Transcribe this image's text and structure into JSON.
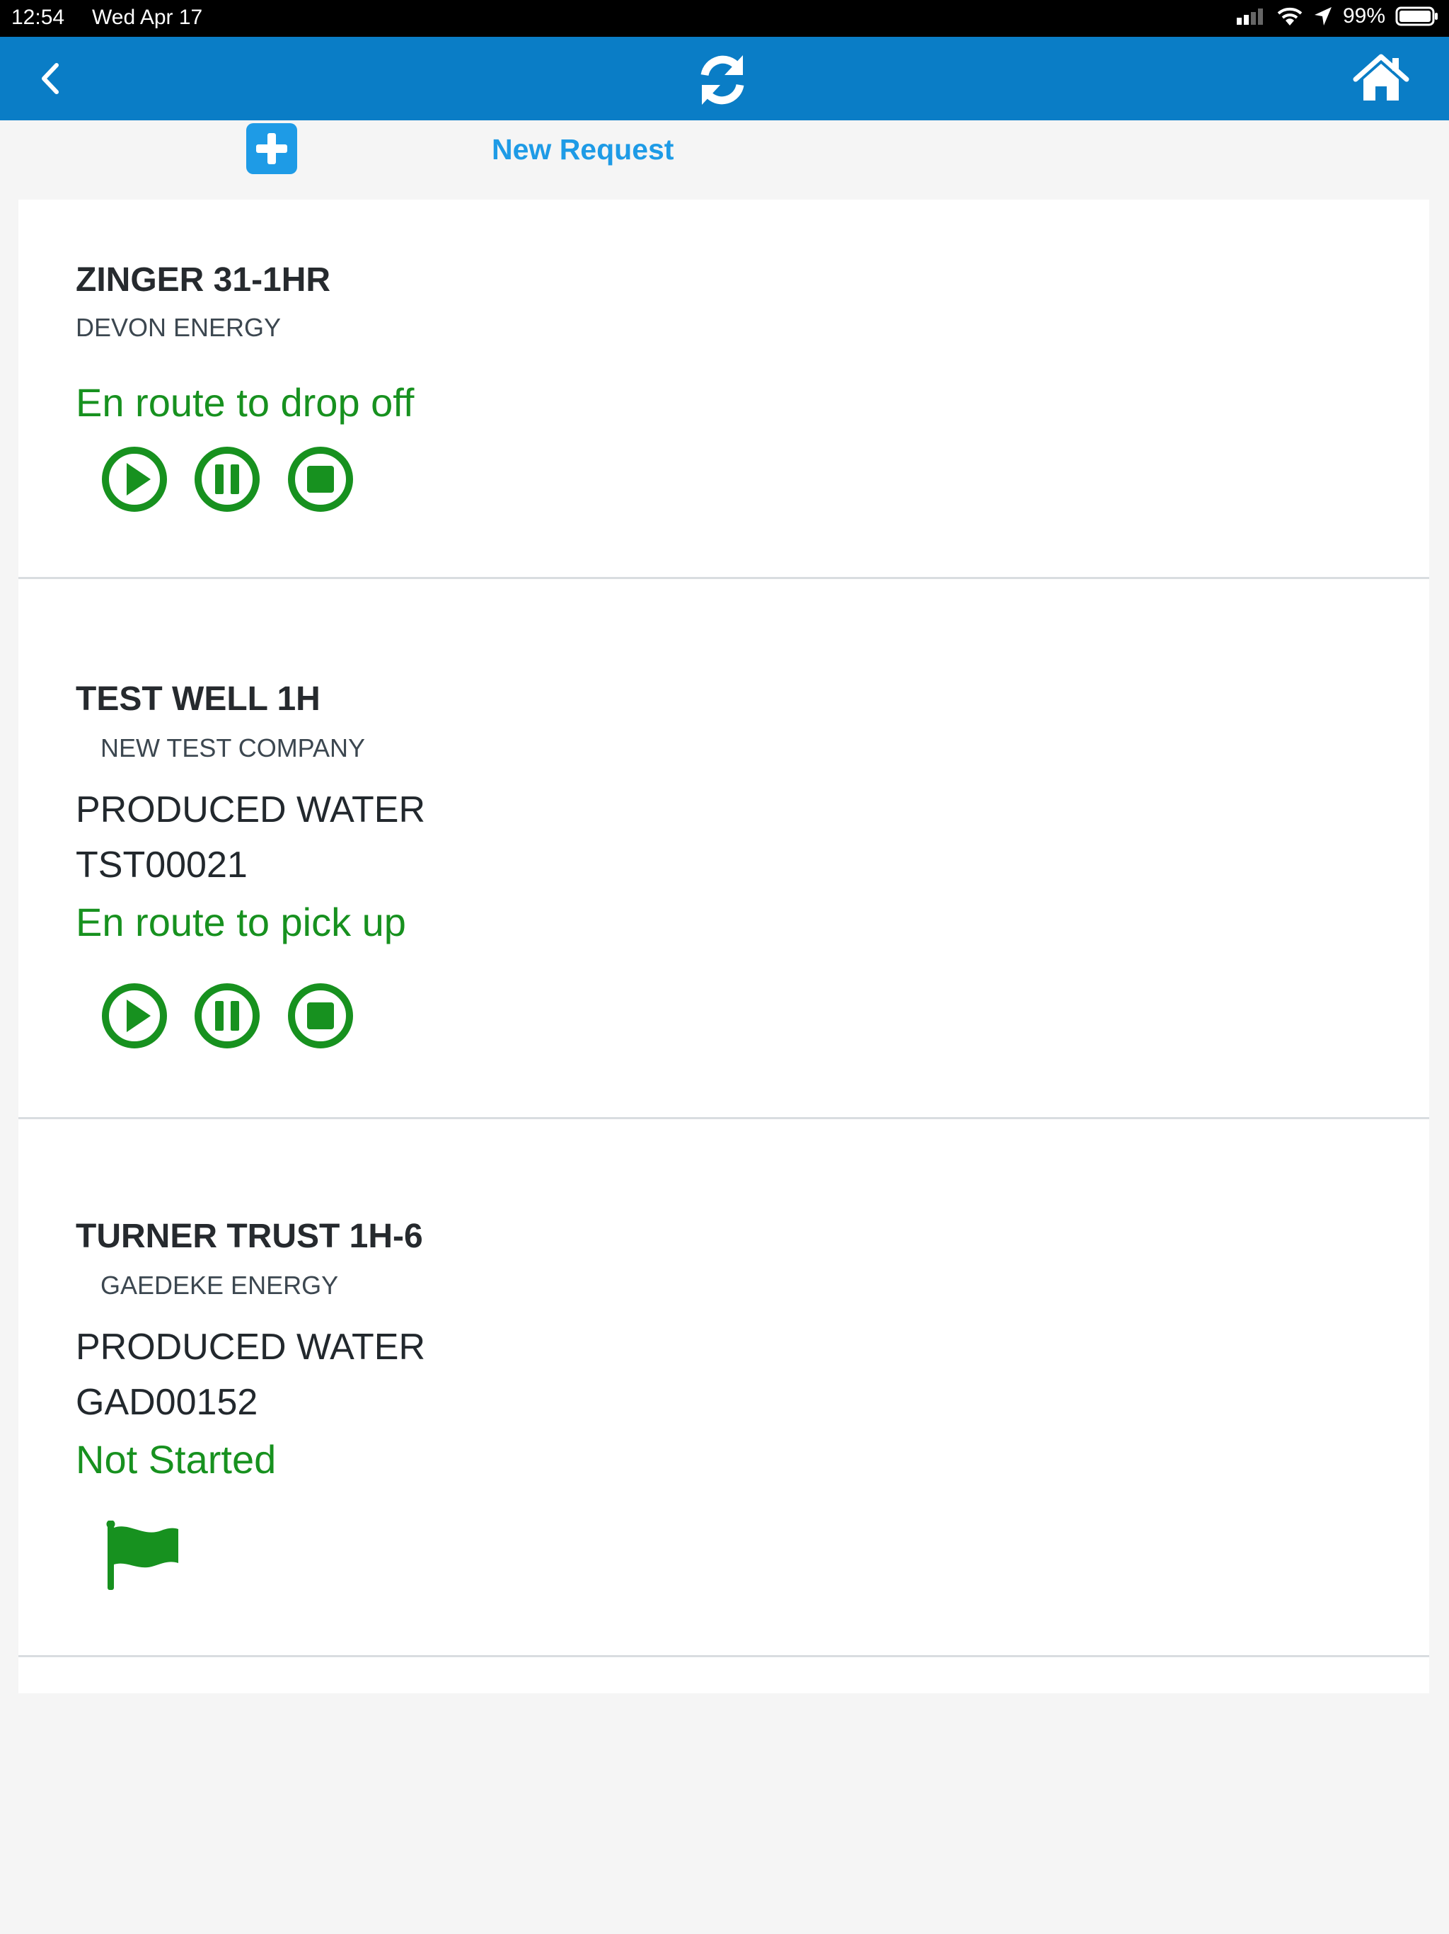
{
  "status_bar": {
    "time": "12:54",
    "date": "Wed Apr 17",
    "battery_percent": "99%"
  },
  "nav": {
    "back_icon": "chevron-left-icon",
    "refresh_icon": "refresh-icon",
    "home_icon": "home-icon",
    "bar_color": "#0a7dc6"
  },
  "toolbar": {
    "new_request_label": "New Request",
    "add_icon": "plus-square-icon",
    "accent_color": "#1e9be6"
  },
  "jobs": [
    {
      "title": "ZINGER 31-1HR",
      "company": "DEVON ENERGY",
      "status": "En route to drop off",
      "controls": [
        "play-icon",
        "pause-icon",
        "stop-icon"
      ]
    },
    {
      "title": "TEST WELL 1H",
      "company": "NEW TEST COMPANY",
      "product": "PRODUCED WATER",
      "ticket": "TST00021",
      "status": "En route to pick up",
      "controls": [
        "play-icon",
        "pause-icon",
        "stop-icon"
      ]
    },
    {
      "title": "TURNER TRUST 1H-6",
      "company": "GAEDEKE ENERGY",
      "product": "PRODUCED WATER",
      "ticket": "GAD00152",
      "status": "Not Started",
      "controls": [
        "flag-icon"
      ]
    }
  ],
  "status_color": "#17911f"
}
